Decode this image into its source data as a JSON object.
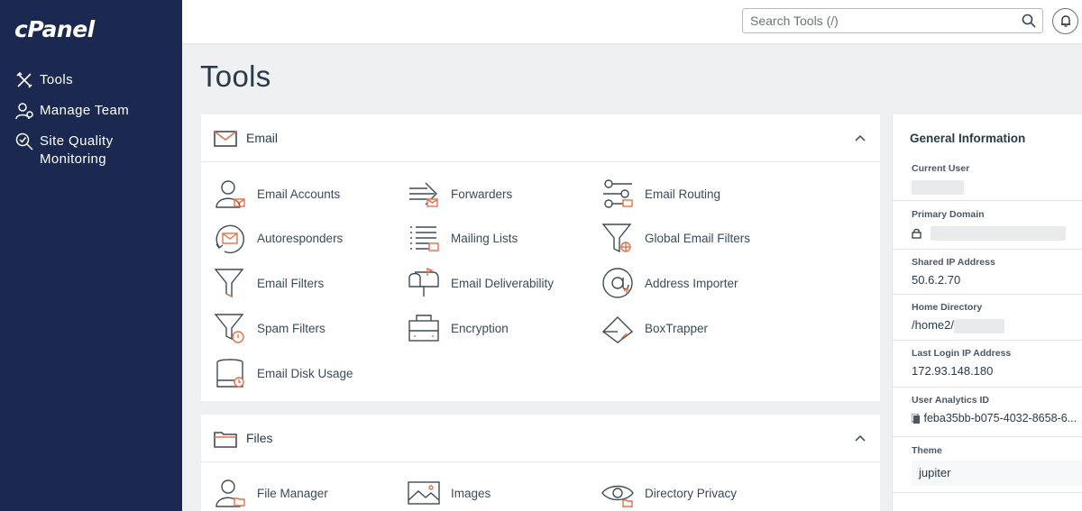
{
  "app": {
    "logo": "cPanel"
  },
  "sidebar": {
    "items": [
      {
        "label": "Tools",
        "icon": "tools-icon"
      },
      {
        "label": "Manage Team",
        "icon": "manage-team-icon"
      },
      {
        "label": "Site Quality Monitoring",
        "icon": "site-quality-icon"
      }
    ]
  },
  "header": {
    "search_placeholder": "Search Tools (/)"
  },
  "page": {
    "title": "Tools"
  },
  "email_section": {
    "title": "Email",
    "tools": [
      {
        "label": "Email Accounts",
        "icon": "email-accounts-icon"
      },
      {
        "label": "Forwarders",
        "icon": "forwarders-icon"
      },
      {
        "label": "Email Routing",
        "icon": "email-routing-icon"
      },
      {
        "label": "Autoresponders",
        "icon": "autoresponders-icon"
      },
      {
        "label": "Mailing Lists",
        "icon": "mailing-lists-icon"
      },
      {
        "label": "Global Email Filters",
        "icon": "global-email-filters-icon"
      },
      {
        "label": "Email Filters",
        "icon": "email-filters-icon"
      },
      {
        "label": "Email Deliverability",
        "icon": "email-deliverability-icon"
      },
      {
        "label": "Address Importer",
        "icon": "address-importer-icon"
      },
      {
        "label": "Spam Filters",
        "icon": "spam-filters-icon"
      },
      {
        "label": "Encryption",
        "icon": "encryption-icon"
      },
      {
        "label": "BoxTrapper",
        "icon": "boxtrapper-icon"
      },
      {
        "label": "Email Disk Usage",
        "icon": "email-disk-usage-icon"
      }
    ]
  },
  "files_section": {
    "title": "Files",
    "tools": [
      {
        "label": "File Manager",
        "icon": "file-manager-icon"
      },
      {
        "label": "Images",
        "icon": "images-icon"
      },
      {
        "label": "Directory Privacy",
        "icon": "directory-privacy-icon"
      }
    ]
  },
  "general_info": {
    "title": "General Information",
    "current_user_label": "Current User",
    "primary_domain_label": "Primary Domain",
    "shared_ip_label": "Shared IP Address",
    "shared_ip_value": "50.6.2.70",
    "home_dir_label": "Home Directory",
    "home_dir_value": "/home2/",
    "last_login_label": "Last Login IP Address",
    "last_login_value": "172.93.148.180",
    "analytics_label": "User Analytics ID",
    "analytics_value": "feba35bb-b075-4032-8658-6...",
    "theme_label": "Theme",
    "theme_value": "jupiter"
  },
  "colors": {
    "sidebar_bg": "#1b2850",
    "accent_orange": "#e4704a",
    "icon_gray": "#3f4a55"
  }
}
